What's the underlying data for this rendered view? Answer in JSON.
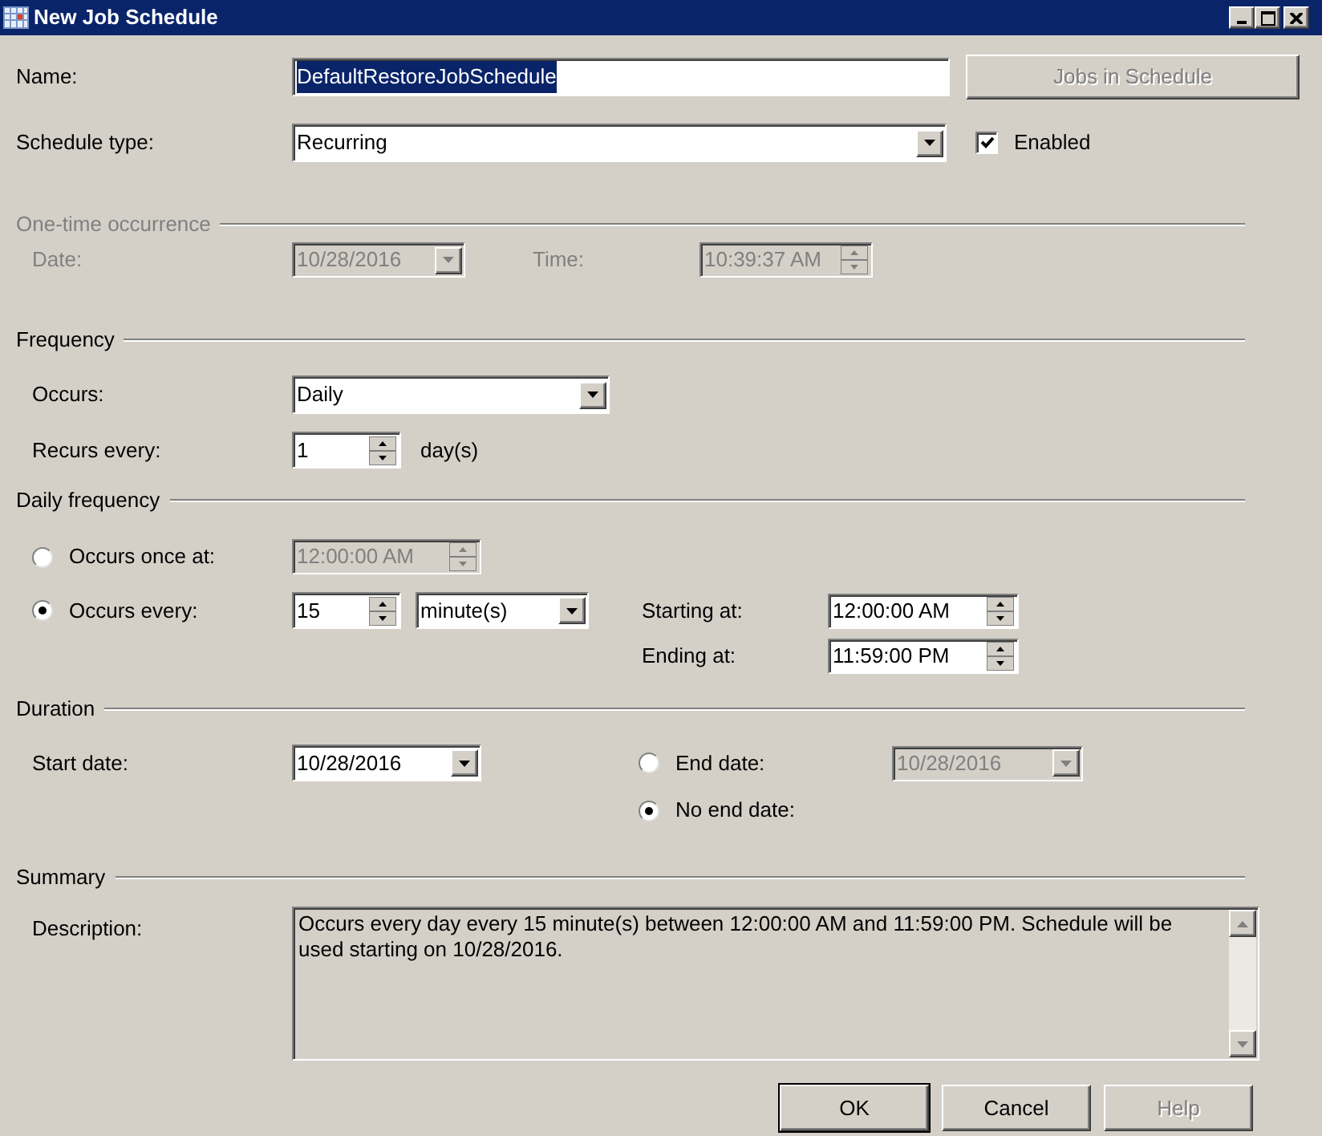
{
  "window": {
    "title": "New Job Schedule"
  },
  "name": {
    "label": "Name:",
    "value": "DefaultRestoreJobSchedule",
    "text_selected": true
  },
  "jobs_button": {
    "label": "Jobs in Schedule",
    "disabled": true
  },
  "schedule_type": {
    "label": "Schedule type:",
    "value": "Recurring"
  },
  "enabled": {
    "label": "Enabled",
    "checked": true
  },
  "one_time": {
    "title": "One-time occurrence",
    "disabled": true,
    "date_label": "Date:",
    "date": "10/28/2016",
    "time_label": "Time:",
    "time": "10:39:37 AM"
  },
  "frequency": {
    "title": "Frequency",
    "occurs_label": "Occurs:",
    "occurs": "Daily",
    "recurs_label": "Recurs every:",
    "recurs": "1",
    "recurs_unit": "day(s)"
  },
  "daily_frequency": {
    "title": "Daily frequency",
    "options": [
      {
        "label": "Occurs once at:",
        "selected": false,
        "time": "12:00:00 AM"
      },
      {
        "label": "Occurs every:",
        "selected": true,
        "interval": "15",
        "unit": "minute(s)"
      }
    ],
    "starting_label": "Starting at:",
    "starting": "12:00:00 AM",
    "ending_label": "Ending at:",
    "ending": "11:59:00 PM"
  },
  "duration": {
    "title": "Duration",
    "start_label": "Start date:",
    "start": "10/28/2016",
    "end_options": [
      {
        "label": "End date:",
        "selected": false,
        "date": "10/28/2016"
      },
      {
        "label": "No end date:",
        "selected": true
      }
    ]
  },
  "summary": {
    "title": "Summary",
    "description_label": "Description:",
    "description": "Occurs every day every 15 minute(s) between 12:00:00 AM and 11:59:00 PM. Schedule will be used starting on 10/28/2016."
  },
  "buttons": [
    {
      "label": "OK",
      "default": true,
      "disabled": false
    },
    {
      "label": "Cancel",
      "default": false,
      "disabled": false
    },
    {
      "label": "Help",
      "default": false,
      "disabled": true
    }
  ]
}
